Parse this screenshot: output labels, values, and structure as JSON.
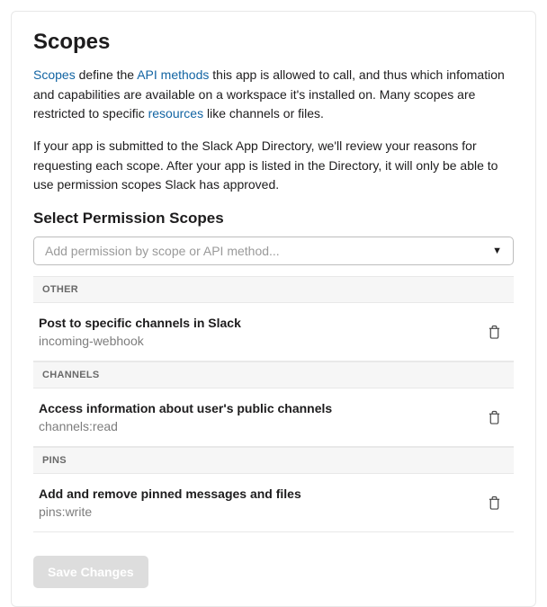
{
  "heading": "Scopes",
  "intro": {
    "link1": "Scopes",
    "text1": " define the ",
    "link2": "API methods",
    "text2": " this app is allowed to call, and thus which infomation and capabilities are available on a workspace it's installed on. Many scopes are restricted to specific ",
    "link3": "resources",
    "text3": " like channels or files."
  },
  "note": "If your app is submitted to the Slack App Directory, we'll review your reasons for requesting each scope. After your app is listed in the Directory, it will only be able to use permission scopes Slack has approved.",
  "select_label": "Select Permission Scopes",
  "select_placeholder": "Add permission by scope or API method...",
  "groups": [
    {
      "name": "OTHER",
      "items": [
        {
          "title": "Post to specific channels in Slack",
          "scope": "incoming-webhook"
        }
      ]
    },
    {
      "name": "CHANNELS",
      "items": [
        {
          "title": "Access information about user's public channels",
          "scope": "channels:read"
        }
      ]
    },
    {
      "name": "PINS",
      "items": [
        {
          "title": "Add and remove pinned messages and files",
          "scope": "pins:write"
        }
      ]
    }
  ],
  "save_label": "Save Changes"
}
